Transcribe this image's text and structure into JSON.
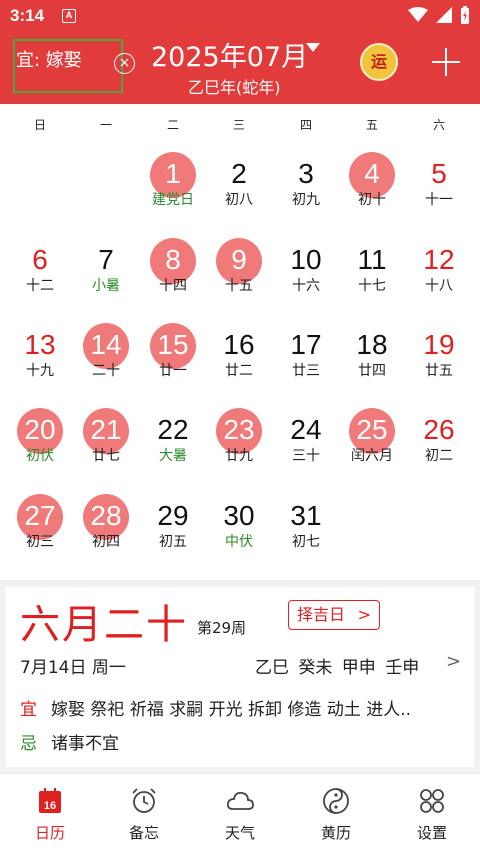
{
  "status": {
    "time": "3:14",
    "notif": "A"
  },
  "header": {
    "yi_text": "宜: 嫁娶",
    "close_glyph": "×",
    "month_title": "2025年07月",
    "year_sub": "乙巳年(蛇年)",
    "yun_glyph": "运"
  },
  "weekdays": [
    "日",
    "一",
    "二",
    "三",
    "四",
    "五",
    "六"
  ],
  "days": [
    {
      "n": "1",
      "l": "建党日",
      "term": true,
      "sel": true,
      "col": 2,
      "row": 0
    },
    {
      "n": "2",
      "l": "初八",
      "col": 3,
      "row": 0
    },
    {
      "n": "3",
      "l": "初九",
      "col": 4,
      "row": 0
    },
    {
      "n": "4",
      "l": "初十",
      "sel": true,
      "col": 5,
      "row": 0
    },
    {
      "n": "5",
      "l": "十一",
      "col": 6,
      "row": 0
    },
    {
      "n": "6",
      "l": "十二",
      "col": 0,
      "row": 1
    },
    {
      "n": "7",
      "l": "小暑",
      "term": true,
      "col": 1,
      "row": 1
    },
    {
      "n": "8",
      "l": "十四",
      "sel": true,
      "col": 2,
      "row": 1
    },
    {
      "n": "9",
      "l": "十五",
      "sel": true,
      "col": 3,
      "row": 1
    },
    {
      "n": "10",
      "l": "十六",
      "col": 4,
      "row": 1
    },
    {
      "n": "11",
      "l": "十七",
      "col": 5,
      "row": 1
    },
    {
      "n": "12",
      "l": "十八",
      "col": 6,
      "row": 1
    },
    {
      "n": "13",
      "l": "十九",
      "col": 0,
      "row": 2
    },
    {
      "n": "14",
      "l": "二十",
      "sel": true,
      "col": 1,
      "row": 2
    },
    {
      "n": "15",
      "l": "廿一",
      "sel": true,
      "col": 2,
      "row": 2
    },
    {
      "n": "16",
      "l": "廿二",
      "col": 3,
      "row": 2
    },
    {
      "n": "17",
      "l": "廿三",
      "col": 4,
      "row": 2
    },
    {
      "n": "18",
      "l": "廿四",
      "col": 5,
      "row": 2
    },
    {
      "n": "19",
      "l": "廿五",
      "col": 6,
      "row": 2
    },
    {
      "n": "20",
      "l": "初伏",
      "term": true,
      "sel": true,
      "col": 0,
      "row": 3
    },
    {
      "n": "21",
      "l": "廿七",
      "sel": true,
      "col": 1,
      "row": 3
    },
    {
      "n": "22",
      "l": "大暑",
      "term": true,
      "col": 2,
      "row": 3
    },
    {
      "n": "23",
      "l": "廿九",
      "sel": true,
      "col": 3,
      "row": 3
    },
    {
      "n": "24",
      "l": "三十",
      "col": 4,
      "row": 3
    },
    {
      "n": "25",
      "l": "闰六月",
      "sel": true,
      "col": 5,
      "row": 3
    },
    {
      "n": "26",
      "l": "初二",
      "col": 6,
      "row": 3
    },
    {
      "n": "27",
      "l": "初三",
      "sel": true,
      "col": 0,
      "row": 4
    },
    {
      "n": "28",
      "l": "初四",
      "sel": true,
      "col": 1,
      "row": 4
    },
    {
      "n": "29",
      "l": "初五",
      "col": 2,
      "row": 4
    },
    {
      "n": "30",
      "l": "中伏",
      "term": true,
      "col": 3,
      "row": 4
    },
    {
      "n": "31",
      "l": "初七",
      "col": 4,
      "row": 4
    }
  ],
  "info": {
    "lunar_date": "六月二十",
    "week_no": "第29周",
    "zeji_label": "择吉日",
    "solar_date": "7月14日 周一",
    "ganzhi": "乙巳 癸未 甲申 壬申",
    "yi_label": "宜",
    "yi_items": "嫁娶 祭祀 祈福 求嗣 开光 拆卸 修造 动土 进人..",
    "ji_label": "忌",
    "ji_items": "诸事不宜"
  },
  "nav": [
    {
      "label": "日历",
      "icon": "calendar-icon",
      "active": true,
      "badge": "16"
    },
    {
      "label": "备忘",
      "icon": "alarm-clock-icon"
    },
    {
      "label": "天气",
      "icon": "cloud-icon"
    },
    {
      "label": "黄历",
      "icon": "yin-yang-icon"
    },
    {
      "label": "设置",
      "icon": "grid-circles-icon"
    }
  ],
  "colors": {
    "brand": "#e23b3b",
    "selected": "#f07a7a",
    "term": "#2e8b2e",
    "weekend": "#e02020"
  }
}
